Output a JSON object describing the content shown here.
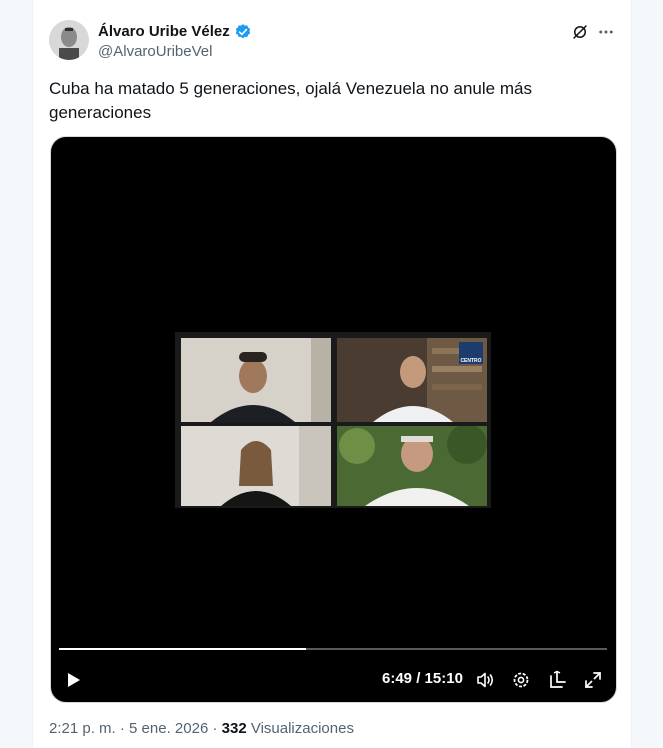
{
  "author": {
    "name": "Álvaro Uribe Vélez",
    "handle": "@AlvaroUribeVel",
    "verified": true,
    "verified_color": "#1d9bf0"
  },
  "header_icons": {
    "grok": "grok-icon",
    "more": "more-options-icon"
  },
  "tweet": {
    "text": "Cuba ha matado 5 generaciones, ojalá Venezuela no anule más generaciones"
  },
  "video": {
    "current_time": "6:49",
    "separator": " / ",
    "duration": "15:10",
    "progress_fraction": 0.45,
    "controls": [
      "play-icon",
      "volume-icon",
      "settings-icon",
      "pip-icon",
      "fullscreen-icon"
    ],
    "overlay_logo_text": "CENTRO"
  },
  "footer": {
    "time": "2:21 p. m.",
    "sep1": " · ",
    "date": "5 ene. 2026",
    "sep2": " · ",
    "views_count": "332",
    "views_label": " Visualizaciones"
  }
}
